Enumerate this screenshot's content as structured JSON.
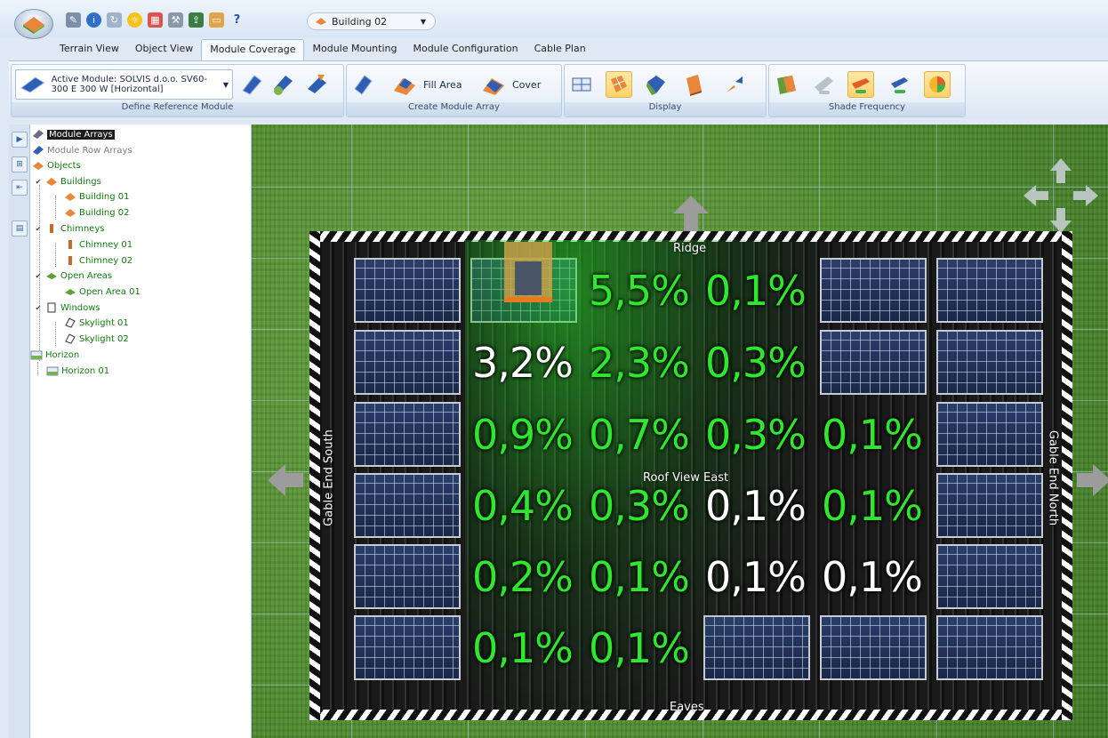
{
  "colors": {
    "shade_green": "#2de82d",
    "shade_white": "#ffffff",
    "panel_blue": "#2b3e6a",
    "ribbon_bg": "#dde8f5",
    "tree_text_green": "#127a0f",
    "selected_node_bg": "#1c1c1c"
  },
  "quickbar": {
    "icons": [
      "wrench-icon",
      "info-icon",
      "refresh-icon",
      "sun-icon",
      "calendar-icon",
      "tools-icon",
      "export-icon",
      "folder-icon",
      "help-icon"
    ],
    "building_select": "Building 02"
  },
  "tabs": [
    "Terrain View",
    "Object View",
    "Module Coverage",
    "Module Mounting",
    "Module Configuration",
    "Cable Plan"
  ],
  "active_tab": "Module Coverage",
  "ribbon": {
    "active_module": "Active Module: SOLVIS d.o.o. SV60-300 E 300 W [Horizontal]",
    "group_define": "Define Reference Module",
    "group_create": "Create Module Array",
    "fill_area": "Fill Area",
    "cover": "Cover",
    "group_display": "Display",
    "group_shade": "Shade Frequency"
  },
  "tree": {
    "module_arrays": "Module Arrays",
    "module_row_arrays": "Module Row Arrays",
    "objects": "Objects",
    "buildings": "Buildings",
    "building_01": "Building 01",
    "building_02": "Building 02",
    "chimneys": "Chimneys",
    "chimney_01": "Chimney 01",
    "chimney_02": "Chimney 02",
    "open_areas": "Open Areas",
    "open_area_01": "Open Area 01",
    "windows": "Windows",
    "skylight_01": "Skylight 01",
    "skylight_02": "Skylight 02",
    "horizon": "Horizon",
    "horizon_01": "Horizon 01"
  },
  "roof": {
    "ridge": "Ridge",
    "eaves": "Eaves",
    "view_name": "Roof View East",
    "gable_south": "Gable End South",
    "gable_north": "Gable End North",
    "shade_values": [
      [
        "",
        "",
        "5,5%",
        "0,1%",
        "",
        ""
      ],
      [
        "",
        "3,2%",
        "2,3%",
        "0,3%",
        "",
        ""
      ],
      [
        "",
        "0,9%",
        "0,7%",
        "0,3%",
        "0,1%",
        ""
      ],
      [
        "",
        "0,4%",
        "0,3%",
        "0,1%",
        "0,1%",
        ""
      ],
      [
        "",
        "0,2%",
        "0,1%",
        "0,1%",
        "0,1%",
        ""
      ],
      [
        "",
        "0,1%",
        "0,1%",
        "",
        "",
        ""
      ]
    ]
  }
}
